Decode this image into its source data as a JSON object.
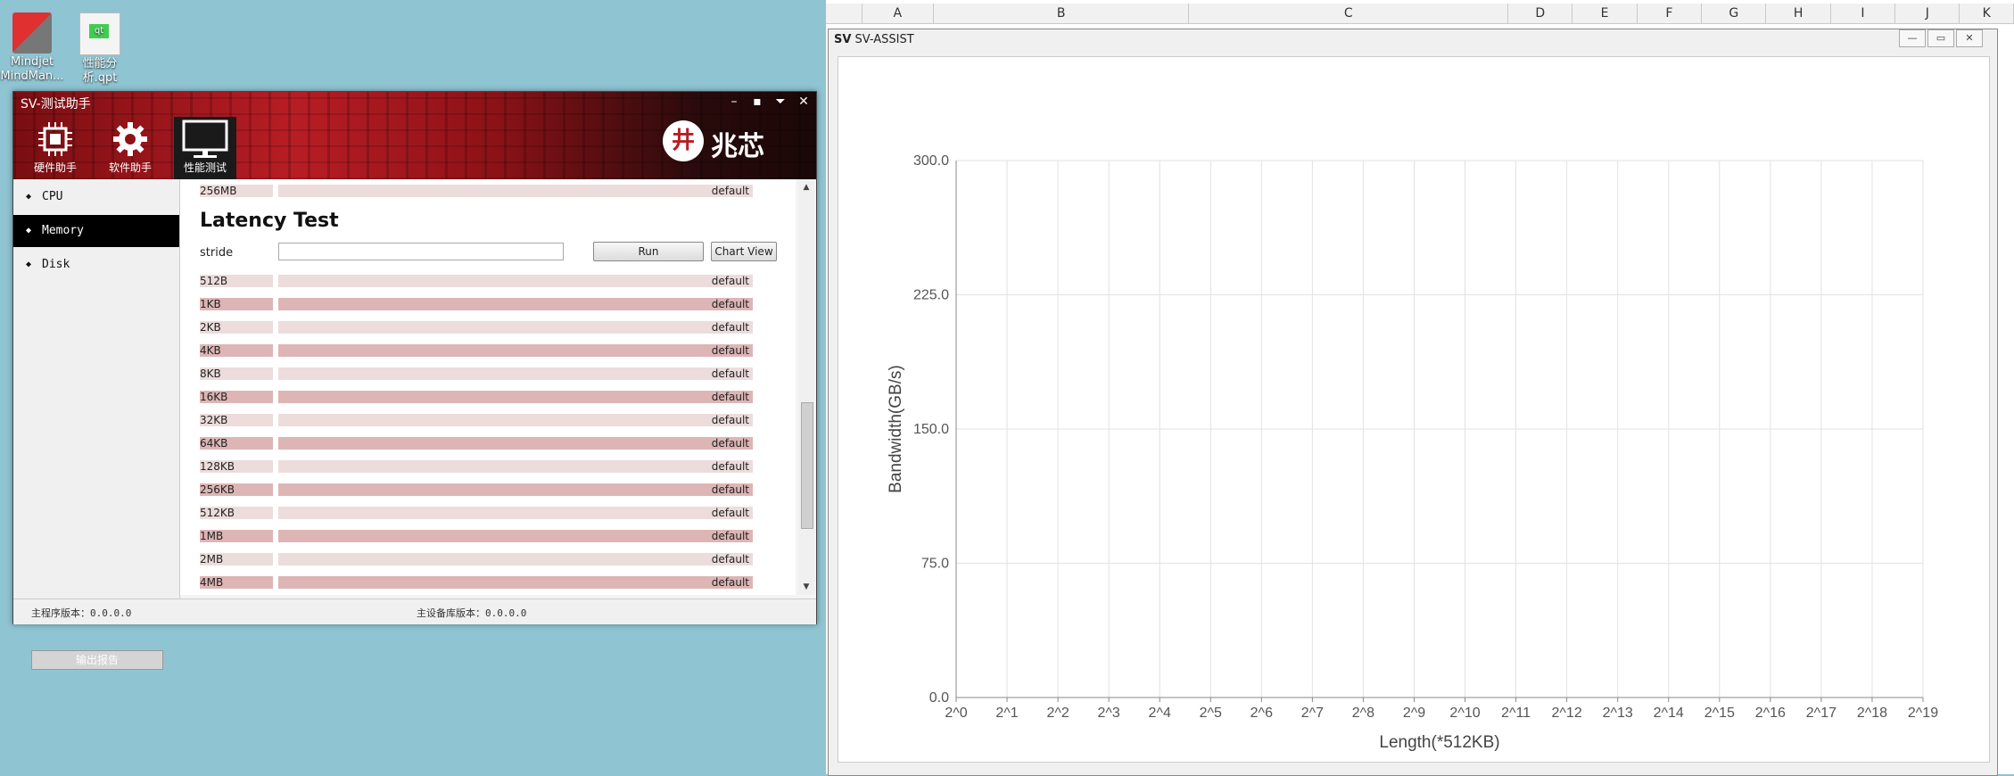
{
  "desktop": {
    "icons": [
      {
        "label": "Mindjet MindMan..."
      },
      {
        "label": "性能分析.qpt"
      }
    ]
  },
  "excel": {
    "columns": [
      "A",
      "B",
      "C",
      "D",
      "E",
      "F",
      "G",
      "H",
      "I",
      "J",
      "K"
    ]
  },
  "sv_window": {
    "title": "SV-测试助手",
    "controls": [
      "–",
      "▪",
      "⏷",
      "✕"
    ],
    "tools": [
      {
        "label": "硬件助手",
        "icon": "chip-icon"
      },
      {
        "label": "软件助手",
        "icon": "gear-icon"
      },
      {
        "label": "性能测试",
        "icon": "monitor-icon"
      }
    ],
    "logo_text": "兆芯",
    "sidebar": {
      "items": [
        "CPU",
        "Memory",
        "Disk"
      ],
      "active": "Memory",
      "export_label": "输出报告"
    },
    "top_row": {
      "label": "256MB",
      "value": "default"
    },
    "latency": {
      "title": "Latency Test",
      "stride_label": "stride",
      "stride_value": "",
      "run_label": "Run",
      "chart_view_label": "Chart View",
      "rows": [
        {
          "label": "512B",
          "value": "default"
        },
        {
          "label": "1KB",
          "value": "default"
        },
        {
          "label": "2KB",
          "value": "default"
        },
        {
          "label": "4KB",
          "value": "default"
        },
        {
          "label": "8KB",
          "value": "default"
        },
        {
          "label": "16KB",
          "value": "default"
        },
        {
          "label": "32KB",
          "value": "default"
        },
        {
          "label": "64KB",
          "value": "default"
        },
        {
          "label": "128KB",
          "value": "default"
        },
        {
          "label": "256KB",
          "value": "default"
        },
        {
          "label": "512KB",
          "value": "default"
        },
        {
          "label": "1MB",
          "value": "default"
        },
        {
          "label": "2MB",
          "value": "default"
        },
        {
          "label": "4MB",
          "value": "default"
        }
      ]
    },
    "status": {
      "main_version": "主程序版本：0.0.0.0",
      "device_version": "主设备库版本：0.0.0.0"
    }
  },
  "assist_window": {
    "badge": "SV",
    "title": "SV-ASSIST"
  },
  "chart_data": {
    "type": "line",
    "xlabel": "Length(*512KB)",
    "ylabel": "Bandwidth(GB/s)",
    "x": [
      "2^0",
      "2^1",
      "2^2",
      "2^3",
      "2^4",
      "2^5",
      "2^6",
      "2^7",
      "2^8",
      "2^9",
      "2^10",
      "2^11",
      "2^12",
      "2^13",
      "2^14",
      "2^15",
      "2^16",
      "2^17",
      "2^18",
      "2^19"
    ],
    "yticks": [
      "0.0",
      "75.0",
      "150.0",
      "225.0",
      "300.0"
    ],
    "ylim": [
      0,
      300
    ],
    "series": [],
    "grid": true
  }
}
